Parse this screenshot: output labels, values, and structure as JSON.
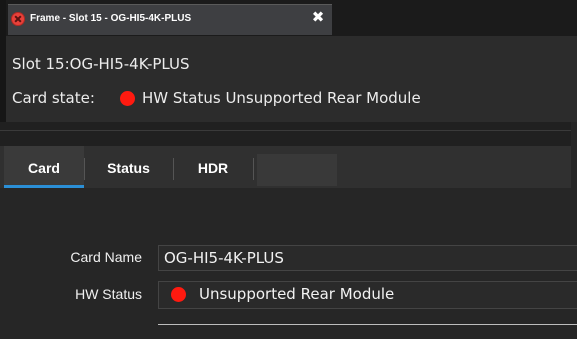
{
  "window_tab": {
    "title": "Frame - Slot 15 - OG-HI5-4K-PLUS",
    "close_glyph": "✖",
    "close_icon": "red-circle-close-icon"
  },
  "header": {
    "slot_text": "Slot 15:OG-HI5-4K-PLUS",
    "card_state_label": "Card state:",
    "card_state_value": "HW Status Unsupported Rear Module",
    "status_color": "#ff1a10"
  },
  "tabs": [
    {
      "label": "Card",
      "active": true
    },
    {
      "label": "Status",
      "active": false
    },
    {
      "label": "HDR",
      "active": false
    }
  ],
  "fields": {
    "card_name_label": "Card Name",
    "card_name_value": "OG-HI5-4K-PLUS",
    "hw_status_label": "HW Status",
    "hw_status_value": "Unsupported Rear Module"
  },
  "colors": {
    "accent": "#2b8fd6",
    "error": "#ff1a10"
  }
}
